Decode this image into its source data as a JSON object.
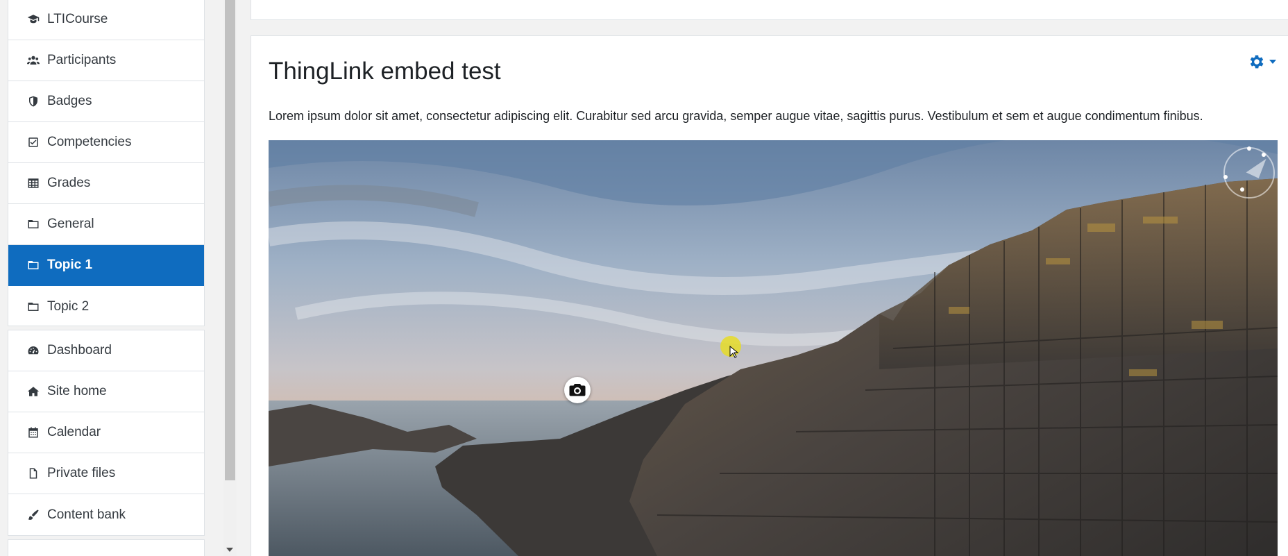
{
  "sidebar": {
    "course_items": [
      {
        "label": "LTICourse",
        "icon": "graduation-cap-icon",
        "active": false
      },
      {
        "label": "Participants",
        "icon": "users-icon",
        "active": false
      },
      {
        "label": "Badges",
        "icon": "shield-icon",
        "active": false
      },
      {
        "label": "Competencies",
        "icon": "check-square-icon",
        "active": false
      },
      {
        "label": "Grades",
        "icon": "table-icon",
        "active": false
      },
      {
        "label": "General",
        "icon": "folder-icon",
        "active": false
      },
      {
        "label": "Topic 1",
        "icon": "folder-icon",
        "active": true
      },
      {
        "label": "Topic 2",
        "icon": "folder-icon",
        "active": false
      }
    ],
    "site_items": [
      {
        "label": "Dashboard",
        "icon": "dashboard-icon"
      },
      {
        "label": "Site home",
        "icon": "home-icon"
      },
      {
        "label": "Calendar",
        "icon": "calendar-icon"
      },
      {
        "label": "Private files",
        "icon": "file-icon"
      },
      {
        "label": "Content bank",
        "icon": "paint-brush-icon"
      }
    ]
  },
  "main": {
    "title": "ThingLink embed test",
    "intro": "Lorem ipsum dolor sit amet, consectetur adipiscing elit. Curabitur sed arcu gravida, semper augue vitae, sagittis purus. Vestibulum et sem et augue condimentum finibus.",
    "settings_icon": "gear-icon",
    "embed": {
      "hotspot_icon": "camera-icon",
      "compass_icon": "compass-icon"
    }
  },
  "colors": {
    "accent": "#0f6cbf",
    "text": "#1d2125",
    "border": "#dee2e6"
  }
}
